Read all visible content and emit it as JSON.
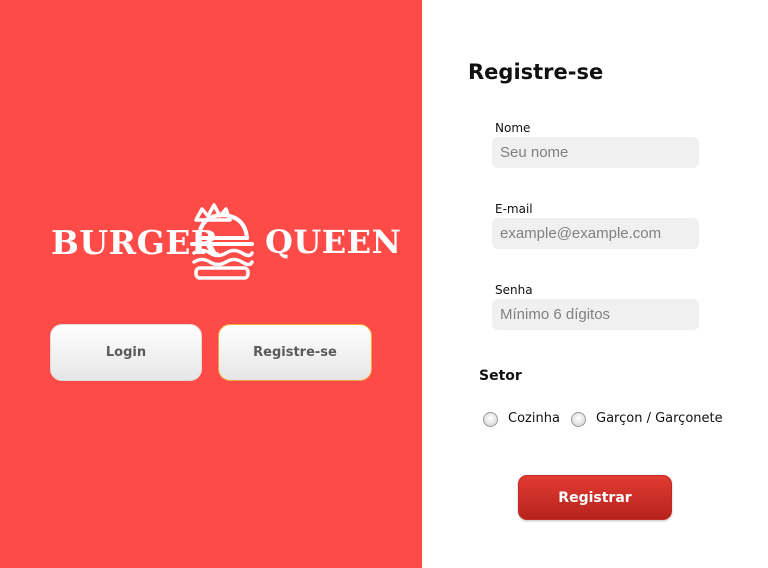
{
  "brand": {
    "word_left": "Burger",
    "word_right": "queen",
    "logo_icon": "burger-crown-icon"
  },
  "nav": {
    "login_label": "Login",
    "register_label": "Registre-se"
  },
  "form": {
    "title": "Registre-se",
    "name": {
      "label": "Nome",
      "placeholder": "Seu nome"
    },
    "email": {
      "label": "E-mail",
      "placeholder": "example@example.com"
    },
    "password": {
      "label": "Senha",
      "placeholder": "Mínimo 6 dígitos"
    },
    "sector": {
      "title": "Setor",
      "options": [
        "Cozinha",
        "Garçon / Garçonete"
      ]
    },
    "submit_label": "Registrar"
  },
  "colors": {
    "brand_red": "#ff4b48",
    "button_red": "#c62a22",
    "input_bg": "#f0f0f0"
  }
}
